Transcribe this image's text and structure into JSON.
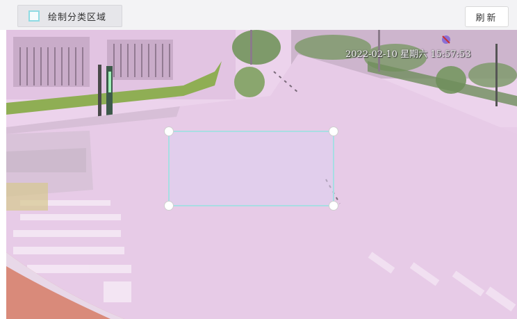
{
  "toolbar": {
    "draw_area_label": "绘制分类区域",
    "draw_area_icon": "square-outline-icon",
    "refresh_label": "刷新"
  },
  "video": {
    "timestamp": "2022-02-10 星期六 15:57:53"
  },
  "colors": {
    "accent": "#8fdbe3",
    "overlay": "#e8cce8",
    "roi_border": "#a8dde3"
  }
}
